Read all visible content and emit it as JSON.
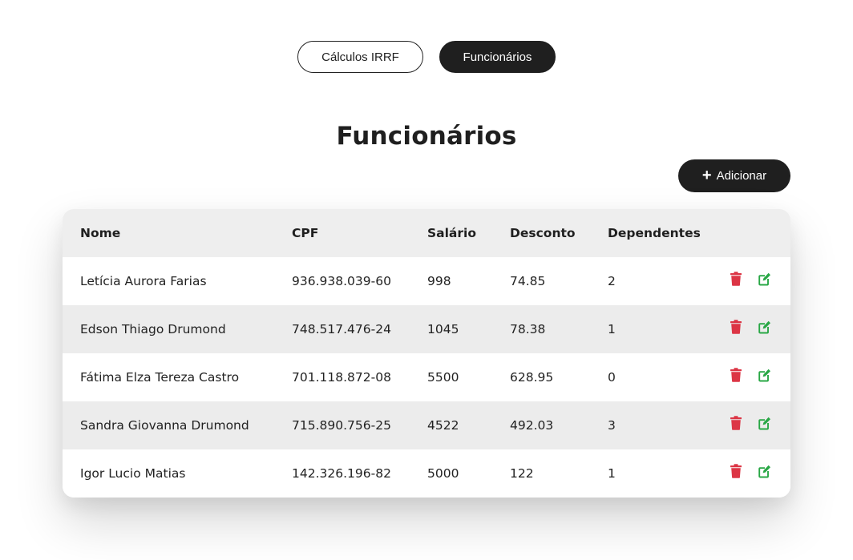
{
  "nav": {
    "calculos_label": "Cálculos IRRF",
    "funcionarios_label": "Funcionários"
  },
  "page": {
    "title": "Funcionários",
    "add_label": "Adicionar"
  },
  "table": {
    "headers": {
      "nome": "Nome",
      "cpf": "CPF",
      "salario": "Salário",
      "desconto": "Desconto",
      "dependentes": "Dependentes"
    },
    "rows": [
      {
        "nome": "Letícia Aurora Farias",
        "cpf": "936.938.039-60",
        "salario": "998",
        "desconto": "74.85",
        "dependentes": "2"
      },
      {
        "nome": "Edson Thiago Drumond",
        "cpf": "748.517.476-24",
        "salario": "1045",
        "desconto": "78.38",
        "dependentes": "1"
      },
      {
        "nome": "Fátima Elza Tereza Castro",
        "cpf": "701.118.872-08",
        "salario": "5500",
        "desconto": "628.95",
        "dependentes": "0"
      },
      {
        "nome": "Sandra Giovanna Drumond",
        "cpf": "715.890.756-25",
        "salario": "4522",
        "desconto": "492.03",
        "dependentes": "3"
      },
      {
        "nome": "Igor Lucio Matias",
        "cpf": "142.326.196-82",
        "salario": "5000",
        "desconto": "122",
        "dependentes": "1"
      }
    ],
    "icons": {
      "delete": "trash-icon",
      "edit": "edit-icon"
    }
  },
  "colors": {
    "primary_dark": "#1f1f1f",
    "delete_red": "#dc3545",
    "edit_green": "#28a745"
  }
}
